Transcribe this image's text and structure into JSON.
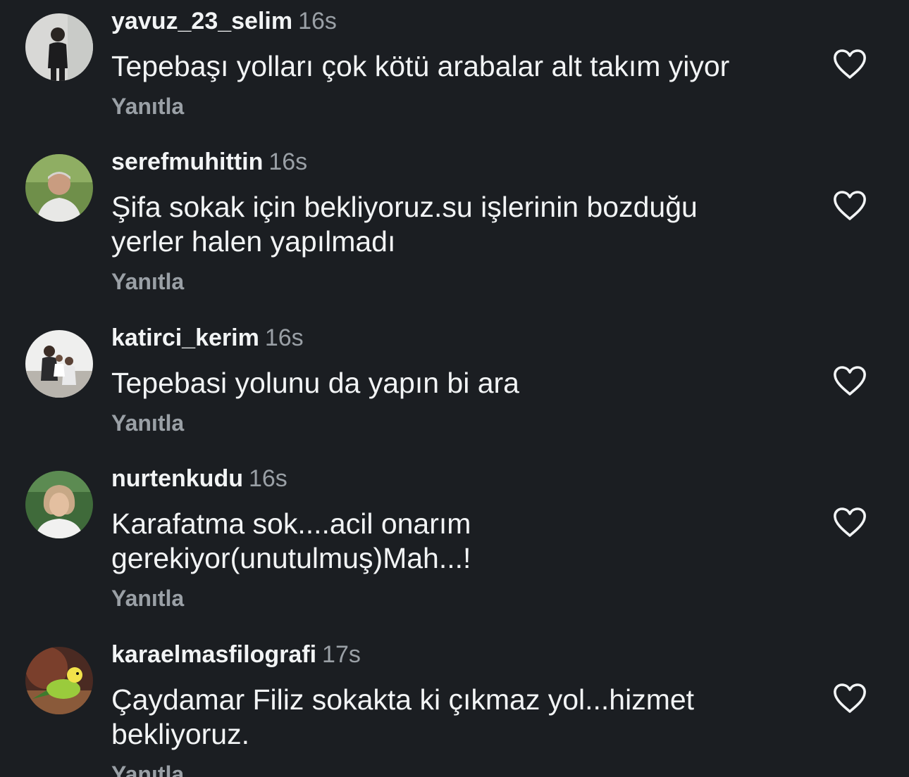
{
  "comments": [
    {
      "username": "yavuz_23_selim",
      "time": "16s",
      "text": "Tepebaşı yolları çok kötü arabalar alt takım yiyor",
      "reply_label": "Yanıtla"
    },
    {
      "username": "serefmuhittin",
      "time": "16s",
      "text": "Şifa sokak için bekliyoruz.su işlerinin bozduğu\nyerler halen yapılmadı",
      "reply_label": "Yanıtla"
    },
    {
      "username": "katirci_kerim",
      "time": "16s",
      "text": "Tepebasi yolunu da yapın bi ara",
      "reply_label": "Yanıtla"
    },
    {
      "username": "nurtenkudu",
      "time": "16s",
      "text": "Karafatma sok....acil onarım\ngerekiyor(unutulmuş)Mah...!",
      "reply_label": "Yanıtla"
    },
    {
      "username": "karaelmasfilografi",
      "time": "17s",
      "text": "Çaydamar Filiz sokakta ki çıkmaz yol...hizmet\nbekliyoruz.",
      "reply_label": "Yanıtla"
    }
  ],
  "icons": {
    "like": "heart-outline-icon"
  },
  "colors": {
    "background": "#1b1e22",
    "primary_text": "#f2f4f5",
    "secondary_text": "#9aa0a6"
  }
}
